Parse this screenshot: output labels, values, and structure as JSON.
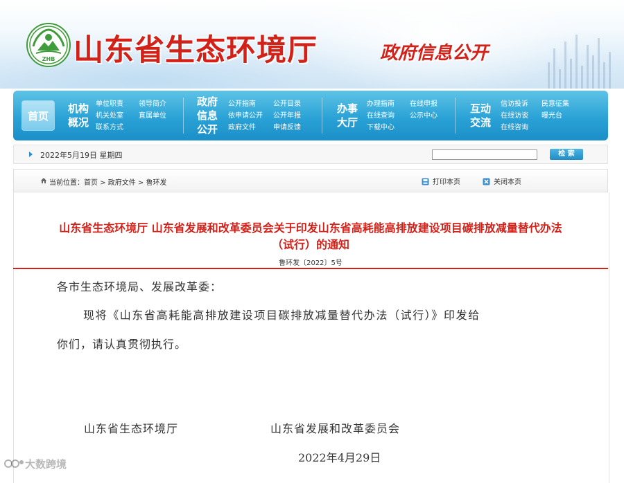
{
  "header": {
    "site_title": "山东省生态环境厅",
    "gov_info_label": "政府信息公开",
    "logo_text": "ZHB"
  },
  "nav": {
    "home_label": "首页",
    "groups": [
      {
        "category": [
          "机构",
          "概况"
        ],
        "links": [
          "单位职责",
          "领导简介",
          "机关处室",
          "直属单位",
          "联系方式"
        ]
      },
      {
        "category": [
          "政府",
          "信息",
          "公开"
        ],
        "links": [
          "公开指南",
          "公开目录",
          "依申请公开",
          "公开年报",
          "政府文件",
          "申请反馈"
        ]
      },
      {
        "category": [
          "办事",
          "大厅"
        ],
        "links": [
          "办理指南",
          "在线申报",
          "在线查询",
          "公示中心",
          "下载中心"
        ]
      },
      {
        "category": [
          "互动",
          "交流"
        ],
        "links": [
          "信访投诉",
          "民意征集",
          "在线访谈",
          "曝光台",
          "在线咨询"
        ]
      }
    ]
  },
  "datebar": {
    "date": "2022年5月19日 星期四",
    "search_placeholder": "",
    "search_label": "检 索"
  },
  "breadcrumb": {
    "text": "当前位置：首页 > 政府文件 > 鲁环发",
    "print_label": "打印本页",
    "close_label": "关闭本页"
  },
  "document": {
    "title_line1": "山东省生态环境厅 山东省发展和改革委员会关于印发山东省高耗能高排放建设项目碳排放减量替代办法",
    "title_line2": "（试行）的通知",
    "doc_number": "鲁环发〔2022〕5号",
    "salutation": "各市生态环境局、发展改革委：",
    "para_line1": "现将《山东省高耗能高排放建设项目碳排放减量替代办法（试行）》印发给",
    "para_line2": "你们，请认真贯彻执行。",
    "signer1": "山东省生态环境厅",
    "signer2": "山东省发展和改革委员会",
    "sign_date": "2022年4月29日"
  },
  "watermark": {
    "text": "大数跨境"
  },
  "colors": {
    "title_red": "#d22119",
    "nav_blue": "#2aa2d6",
    "rule_red": "#d22119"
  }
}
